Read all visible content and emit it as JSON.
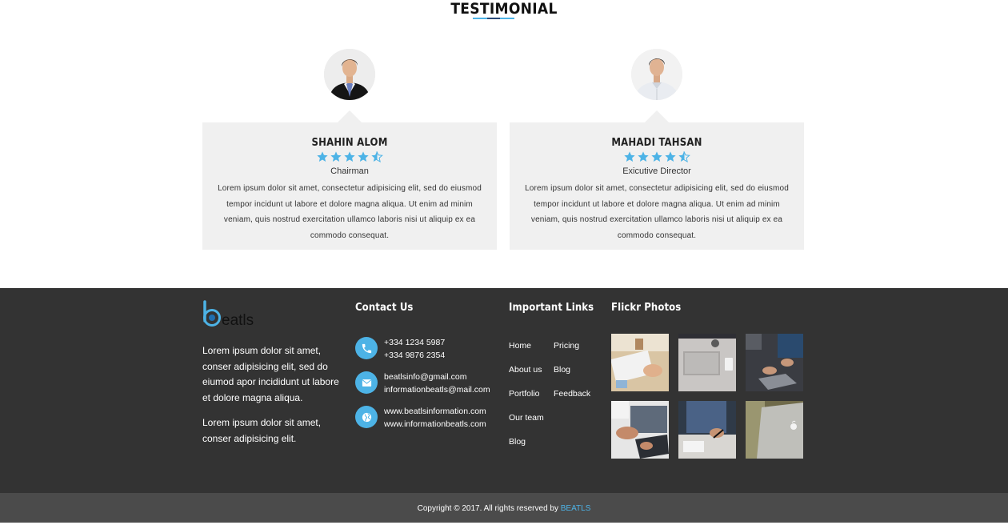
{
  "testimonial": {
    "title": "TESTIMONIAL",
    "cards": [
      {
        "name": "SHAHIN ALOM",
        "role": "Chairman",
        "rating": 4.5,
        "quote": "Lorem ipsum dolor sit amet, consectetur adipisicing elit, sed do eiusmod tempor incidunt ut labore et dolore magna aliqua. Ut enim ad minim veniam, quis nostrud exercitation ullamco laboris nisi ut aliquip ex ea commodo consequat."
      },
      {
        "name": "MAHADI TAHSAN",
        "role": "Exicutive Director",
        "rating": 4.5,
        "quote": "Lorem ipsum dolor sit amet, consectetur adipisicing elit, sed do eiusmod tempor incidunt ut labore et dolore magna aliqua. Ut enim ad minim veniam, quis nostrud exercitation ullamco laboris nisi ut aliquip ex ea commodo consequat."
      }
    ]
  },
  "footer": {
    "logo_text": "eatls",
    "about": [
      "Lorem ipsum dolor sit amet, conser adipisicing elit, sed do eiumod apor incididunt ut labore et dolore magna aliqua.",
      "Lorem ipsum dolor sit amet, conser adipisicing elit."
    ],
    "contact": {
      "title": "Contact Us",
      "phone_icon": "phone-icon",
      "phones": [
        "+334 1234 5987",
        "+334 9876 2354"
      ],
      "email_icon": "envelope-icon",
      "emails": [
        "beatlsinfo@gmail.com",
        "informationbeatls@mail.com"
      ],
      "web_icon": "globe-icon",
      "websites": [
        "www.beatlsinformation.com",
        "www.informationbeatls.com"
      ]
    },
    "links": {
      "title": "Important Links",
      "col1": [
        "Home",
        "About us",
        "Portfolio",
        "Our team",
        "Blog"
      ],
      "col2": [
        "Pricing",
        "Blog",
        "Feedback"
      ]
    },
    "flickr": {
      "title": "Flickr Photos"
    }
  },
  "copyright": {
    "text": "Copyright © 2017. All rights reserved by ",
    "brand": "BEATLS"
  },
  "colors": {
    "accent": "#4db3e6",
    "footer_bg": "#333333",
    "copyright_bg": "#4b4b4b",
    "card_bg": "#f0f0f0"
  }
}
